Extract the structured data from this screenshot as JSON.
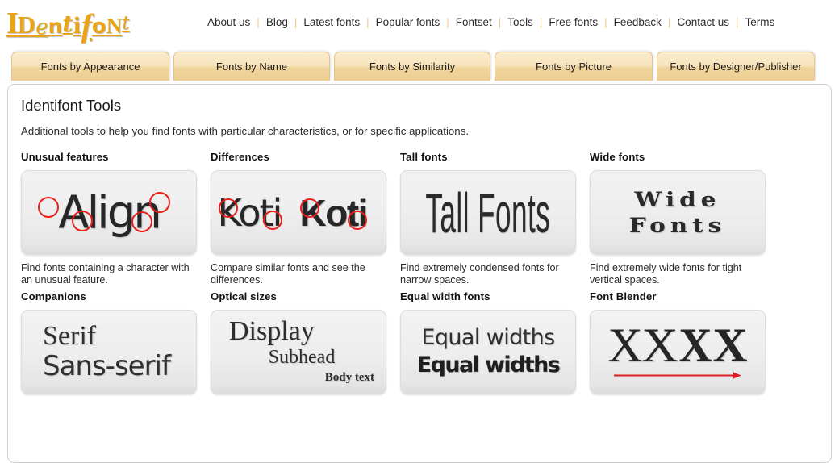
{
  "site": {
    "logo_text": "Identifont",
    "logo_letters": [
      "I",
      "D",
      "e",
      "n",
      "t",
      "i",
      "f",
      "o",
      "N",
      "t"
    ],
    "logo_color": "#E8A317"
  },
  "topnav": {
    "separator": "|",
    "items": [
      {
        "label": "About us"
      },
      {
        "label": "Blog"
      },
      {
        "label": "Latest fonts"
      },
      {
        "label": "Popular fonts"
      },
      {
        "label": "Fontset"
      },
      {
        "label": "Tools"
      },
      {
        "label": "Free fonts"
      },
      {
        "label": "Feedback"
      },
      {
        "label": "Contact us"
      },
      {
        "label": "Terms"
      }
    ]
  },
  "tabs": [
    {
      "label": "Fonts by Appearance"
    },
    {
      "label": "Fonts by Name"
    },
    {
      "label": "Fonts by Similarity"
    },
    {
      "label": "Fonts by Picture"
    },
    {
      "label": "Fonts by Designer/Publisher"
    }
  ],
  "main": {
    "title": "Identifont Tools",
    "description": "Additional tools to help you find fonts with particular characteristics, or for specific applications."
  },
  "tools": [
    {
      "title": "Unusual features",
      "caption": "Find fonts containing a character with an unusual feature.",
      "sample_text": "Align",
      "marker_color": "#e8201c"
    },
    {
      "title": "Differences",
      "caption": "Compare similar fonts and see the differences.",
      "sample_text_a": "Koti",
      "sample_text_b": "Koti",
      "marker_color": "#e8201c"
    },
    {
      "title": "Tall fonts",
      "caption": "Find extremely condensed fonts for narrow spaces.",
      "sample_text": "Tall Fonts"
    },
    {
      "title": "Wide fonts",
      "caption": "Find extremely wide fonts for tight vertical spaces.",
      "sample_line1": "Wide",
      "sample_line2": "Fonts"
    },
    {
      "title": "Companions",
      "caption": "",
      "sample_serif": "Serif",
      "sample_sans": "Sans-serif"
    },
    {
      "title": "Optical sizes",
      "caption": "",
      "sample_display": "Display",
      "sample_subhead": "Subhead",
      "sample_body": "Body text"
    },
    {
      "title": "Equal width fonts",
      "caption": "",
      "sample_regular": "Equal widths",
      "sample_bold": "Equal widths"
    },
    {
      "title": "Font Blender",
      "caption": "",
      "sample_glyphs": [
        "X",
        "X",
        "X",
        "X"
      ],
      "arrow_color": "#e02020"
    }
  ]
}
